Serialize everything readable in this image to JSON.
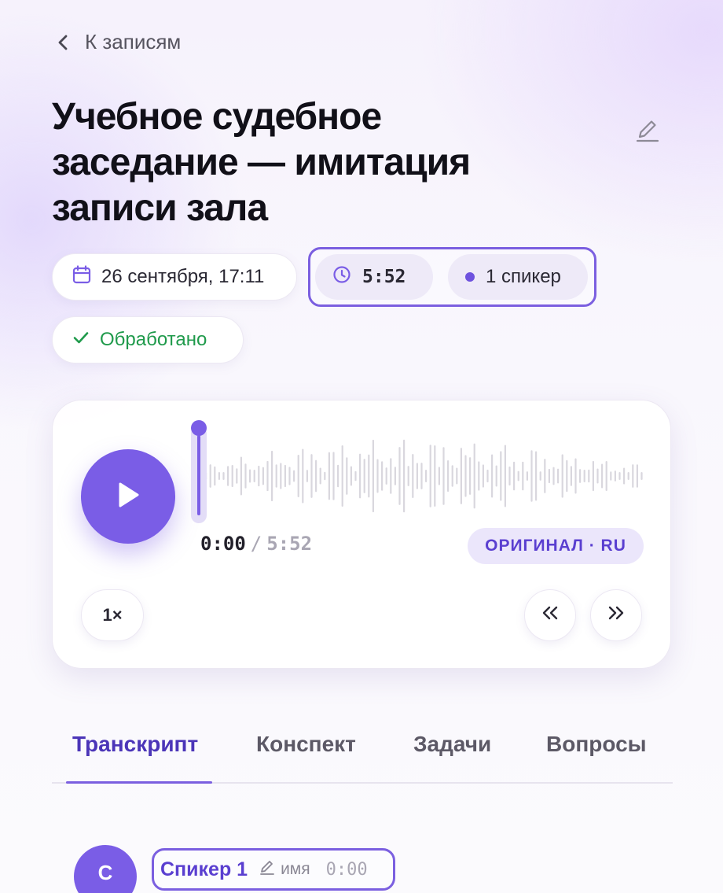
{
  "back": {
    "label": "К записям",
    "icon": "chevron-left-icon"
  },
  "title": "Учебное судебное заседание — имитация записи зала",
  "meta": {
    "date": "26 сентября, 17:11",
    "duration": "5:52",
    "speakers": "1 спикер",
    "status": "Обработано"
  },
  "player": {
    "current_time": "0:00",
    "separator": "/",
    "total_time": "5:52",
    "progress": 0,
    "language": "ОРИГИНАЛ · RU",
    "speed": "1×"
  },
  "tabs": [
    {
      "label": "Транскрипт",
      "active": true
    },
    {
      "label": "Конспект",
      "active": false
    },
    {
      "label": "Задачи",
      "active": false
    },
    {
      "label": "Вопросы",
      "active": false
    }
  ],
  "transcript": {
    "avatar_initial": "С",
    "speaker_name": "Спикер 1",
    "rename_label": "имя",
    "timestamp": "0:00"
  },
  "colors": {
    "accent": "#7a5de6",
    "accent_dark": "#4b35b8",
    "success": "#1f9a4b",
    "wave_bar": "#d9d7de"
  }
}
